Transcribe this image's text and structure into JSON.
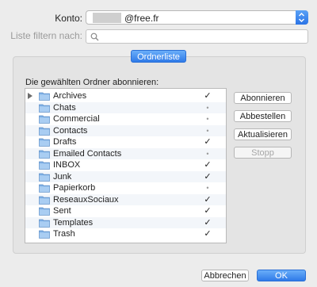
{
  "account": {
    "label": "Konto:",
    "value_visible": "@free.fr"
  },
  "filter": {
    "label": "Liste filtern nach:",
    "placeholder": ""
  },
  "tab": {
    "label": "Ordnerliste"
  },
  "subscribe_label": "Die gewählten Ordner abonnieren:",
  "folders": [
    {
      "name": "Archives",
      "subscribed": true,
      "has_children": true
    },
    {
      "name": "Chats",
      "subscribed": false,
      "has_children": false
    },
    {
      "name": "Commercial",
      "subscribed": false,
      "has_children": false
    },
    {
      "name": "Contacts",
      "subscribed": false,
      "has_children": false
    },
    {
      "name": "Drafts",
      "subscribed": true,
      "has_children": false
    },
    {
      "name": "Emailed Contacts",
      "subscribed": false,
      "has_children": false
    },
    {
      "name": "INBOX",
      "subscribed": true,
      "has_children": false
    },
    {
      "name": "Junk",
      "subscribed": true,
      "has_children": false
    },
    {
      "name": "Papierkorb",
      "subscribed": false,
      "has_children": false
    },
    {
      "name": "ReseauxSociaux",
      "subscribed": true,
      "has_children": false
    },
    {
      "name": "Sent",
      "subscribed": true,
      "has_children": false
    },
    {
      "name": "Templates",
      "subscribed": true,
      "has_children": false
    },
    {
      "name": "Trash",
      "subscribed": true,
      "has_children": false
    }
  ],
  "marks": {
    "checked": "✓",
    "unchecked": "•"
  },
  "buttons": {
    "subscribe": "Abonnieren",
    "unsubscribe": "Abbestellen",
    "refresh": "Aktualisieren",
    "stop": "Stopp",
    "cancel": "Abbrechen",
    "ok": "OK"
  },
  "colors": {
    "accent": "#2f7ae8",
    "folder_icon": "#7fb0e6"
  }
}
